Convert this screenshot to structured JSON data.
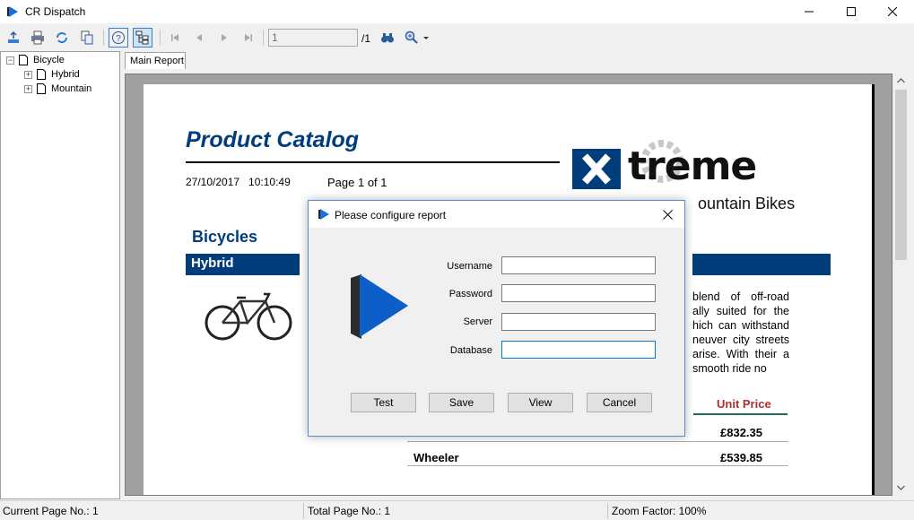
{
  "window": {
    "title": "CR Dispatch"
  },
  "toolbar": {
    "page_input_value": "1",
    "page_total": "/1"
  },
  "tree": {
    "root": "Bicycle",
    "children": [
      "Hybrid",
      "Mountain"
    ]
  },
  "tabs": {
    "main": "Main Report"
  },
  "report": {
    "title": "Product Catalog",
    "datetime": "27/10/2017   10:10:49",
    "page_of": "Page 1 of 1",
    "logo_text": "treme",
    "logo_subtitle": "ountain Bikes",
    "section": "Bicycles",
    "group": "Hybrid",
    "description": "blend of off-road ally suited for the hich can withstand neuver city streets arise. With their a smooth ride no",
    "unit_price_header": "Unit Price",
    "rows": [
      {
        "name": "",
        "price": "£832.35"
      },
      {
        "name": "Wheeler",
        "price": "£539.85"
      }
    ]
  },
  "dialog": {
    "title": "Please configure report",
    "fields": [
      {
        "label": "Username",
        "value": ""
      },
      {
        "label": "Password",
        "value": ""
      },
      {
        "label": "Server",
        "value": ""
      },
      {
        "label": "Database",
        "value": ""
      }
    ],
    "buttons": {
      "test": "Test",
      "save": "Save",
      "view": "View",
      "cancel": "Cancel"
    }
  },
  "status": {
    "current_page": "Current Page No.: 1",
    "total_page": "Total Page No.: 1",
    "zoom": "Zoom Factor: 100%"
  },
  "colors": {
    "report_blue": "#003d7a",
    "price_red": "#b03030",
    "accent": "#0078d7"
  }
}
